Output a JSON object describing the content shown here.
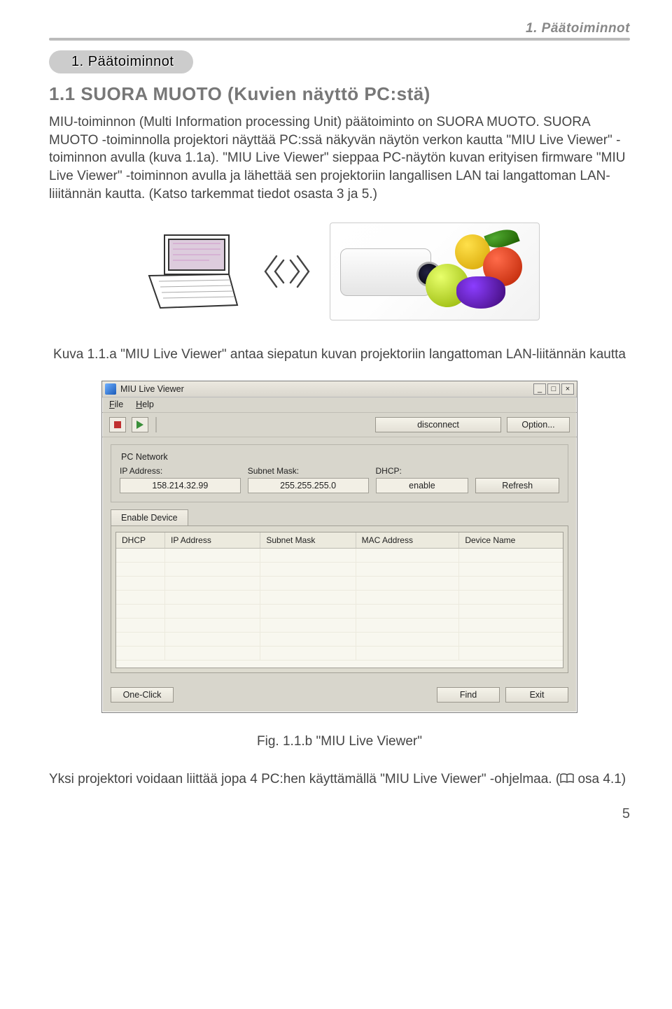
{
  "header": {
    "running": "1. Päätoiminnot"
  },
  "section": {
    "tab": "1. Päätoiminnot",
    "subheading": "1.1 SUORA MUOTO (Kuvien näyttö PC:stä)",
    "body": "MIU-toiminnon (Multi Information processing Unit) päätoiminto on SUORA MUOTO. SUORA MUOTO -toiminnolla projektori näyttää PC:ssä näkyvän näytön verkon kautta \"MIU Live Viewer\" -toiminnon avulla (kuva 1.1a). \"MIU Live Viewer\" sieppaa PC-näytön kuvan erityisen firmware \"MIU Live Viewer\" -toiminnon avulla ja lähettää sen projektoriin langallisen LAN tai langattoman LAN-liiitännän kautta. (Katso tarkemmat tiedot osasta 3 ja 5.)"
  },
  "caption1": "Kuva 1.1.a \"MIU Live Viewer\" antaa siepatun kuvan projektoriin langattoman LAN-liitännän kautta",
  "dialog": {
    "title": "MIU Live Viewer",
    "menus": [
      "File",
      "Help"
    ],
    "toolbar": {
      "disconnect": "disconnect",
      "option": "Option..."
    },
    "pcNetwork": {
      "title": "PC Network",
      "ipLabel": "IP Address:",
      "ipValue": "158.214.32.99",
      "subnetLabel": "Subnet Mask:",
      "subnetValue": "255.255.255.0",
      "dhcpLabel": "DHCP:",
      "dhcpValue": "enable",
      "refresh": "Refresh"
    },
    "tabs": {
      "enable": "Enable Device"
    },
    "columns": [
      "DHCP",
      "IP Address",
      "Subnet Mask",
      "MAC Address",
      "Device Name"
    ],
    "footer": {
      "oneClick": "One-Click",
      "find": "Find",
      "exit": "Exit"
    }
  },
  "caption2": "Fig. 1.1.b \"MIU Live Viewer\"",
  "bottom": {
    "text1": "Yksi projektori voidaan liittää jopa 4 PC:hen käyttämällä \"MIU Live Viewer\" -ohjelmaa. (",
    "text2": " osa 4.1)"
  },
  "pageNumber": "5"
}
